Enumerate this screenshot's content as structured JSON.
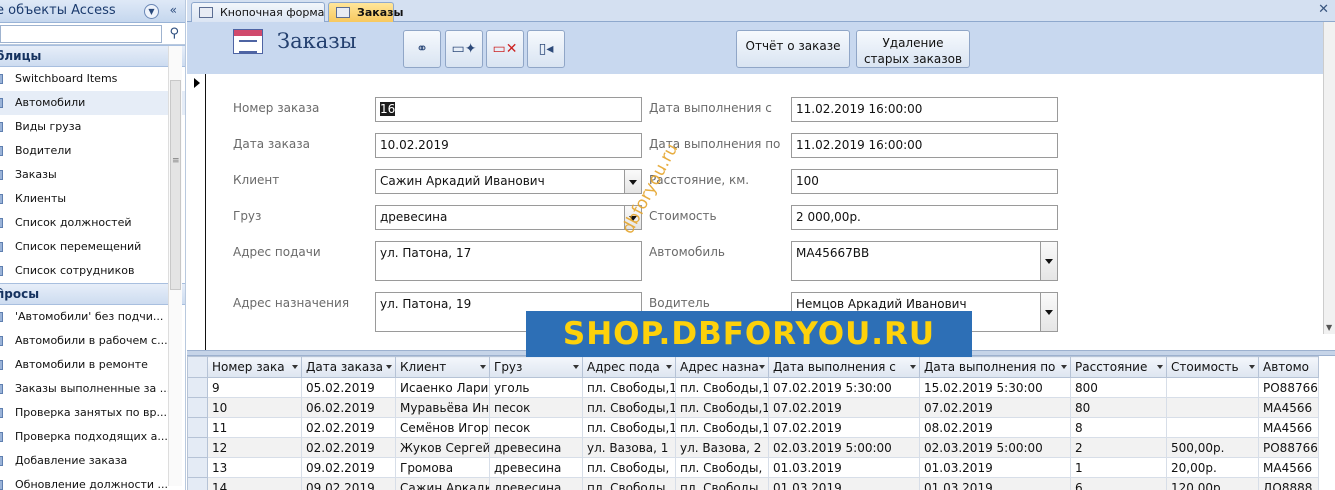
{
  "nav": {
    "title": "е объекты Access",
    "groups": [
      {
        "label": "блицы",
        "items": [
          "Switchboard Items",
          "Автомобили",
          "Виды груза",
          "Водители",
          "Заказы",
          "Клиенты",
          "Список должностей",
          "Список перемещений",
          "Список сотрудников"
        ]
      },
      {
        "label": "просы",
        "items": [
          "'Автомобили' без подчи...",
          "Автомобили в рабочем с...",
          "Автомобили в ремонте",
          "Заказы выполненные за ...",
          "Проверка занятых по вр...",
          "Проверка подходящих а...",
          "Добавление заказа",
          "Обновление должности ..."
        ]
      }
    ]
  },
  "tabs": [
    "Кнопочная форма",
    "Заказы"
  ],
  "form": {
    "title": "Заказы",
    "buttons": [
      "Отчёт о заказе",
      "Удаление старых заказов"
    ],
    "button2_lines": [
      "Удаление",
      "старых заказов"
    ],
    "labels": {
      "order_no": "Номер заказа",
      "order_date": "Дата заказа",
      "client": "Клиент",
      "cargo": "Груз",
      "pickup": "Адрес подачи",
      "dest": "Адрес назначения",
      "from": "Дата выполнения с",
      "to": "Дата выполнения по",
      "distance": "Расстояние, км.",
      "cost": "Стоимость",
      "car": "Автомобиль",
      "driver": "Водитель"
    },
    "values": {
      "order_no": "16",
      "order_date": "10.02.2019",
      "client": "Сажин Аркадий Иванович",
      "cargo": "древесина",
      "pickup": "ул. Патона, 17",
      "dest": "ул. Патона, 19",
      "from": "11.02.2019 16:00:00",
      "to": "11.02.2019 16:00:00",
      "distance": "100",
      "cost": "2 000,00р.",
      "car": "МА45667ВВ",
      "driver": "Немцов Аркадий Иванович"
    }
  },
  "grid": {
    "columns": [
      "Номер зака",
      "Дата заказа",
      "Клиент",
      "Груз",
      "Адрес пода",
      "Адрес назна",
      "Дата выполнения с",
      "Дата выполнения по",
      "Расстояние",
      "Стоимость",
      "Автомо"
    ],
    "rows": [
      [
        "9",
        "05.02.2019",
        "Исаенко Лари",
        "уголь",
        "пл. Свободы,1",
        "пл. Свободы,1",
        "07.02.2019 5:30:00",
        "15.02.2019 5:30:00",
        "800",
        "",
        "РО88766"
      ],
      [
        "10",
        "06.02.2019",
        "Муравьёва Ин",
        "песок",
        "пл. Свободы,1",
        "пл. Свободы,1",
        "07.02.2019",
        "07.02.2019",
        "80",
        "",
        "МА4566"
      ],
      [
        "11",
        "02.02.2019",
        "Семёнов Игор",
        "песок",
        "пл. Свободы,1",
        "пл. Свободы,1",
        "07.02.2019",
        "08.02.2019",
        "8",
        "",
        "МА4566"
      ],
      [
        "12",
        "02.02.2019",
        "Жуков Сергей",
        "древесина",
        "ул. Вазова, 1",
        "ул. Вазова, 2",
        "02.03.2019 5:00:00",
        "02.03.2019 5:00:00",
        "2",
        "500,00р.",
        "РО88766"
      ],
      [
        "13",
        "09.02.2019",
        "Громова",
        "древесина",
        "пл. Свободы,",
        "пл. Свободы,",
        "01.03.2019",
        "01.03.2019",
        "1",
        "20,00р.",
        "МА4566"
      ],
      [
        "14",
        "09.02.2019",
        "Сажин Аркадк",
        "древесина",
        "пл. Свободы,",
        "пл. Свободы,",
        "01.03.2019",
        "01.03.2019",
        "6",
        "120,00р.",
        "ДО8888"
      ]
    ]
  },
  "watermark": "SHOP.DBFORYOU.RU",
  "watermark_diag": "dbforyou.ru"
}
